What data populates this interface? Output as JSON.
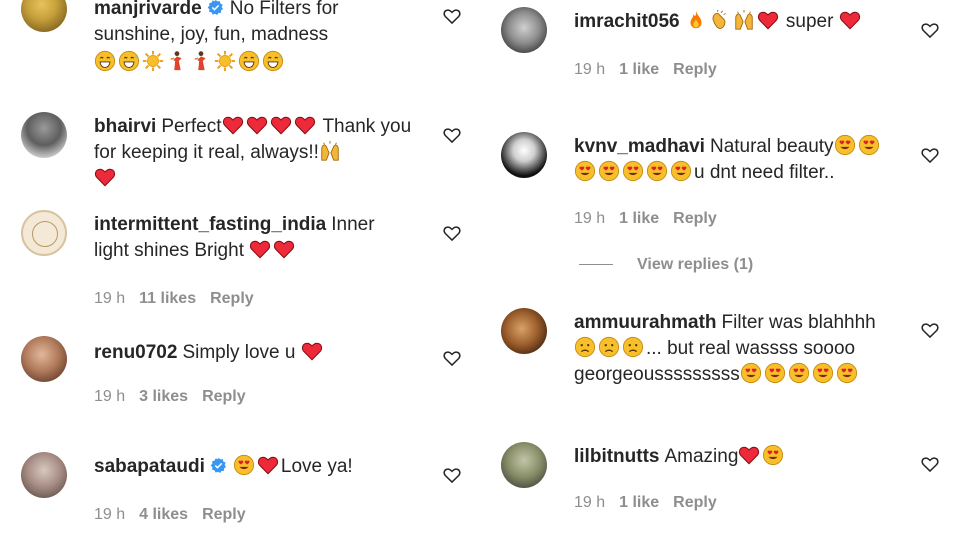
{
  "left": [
    {
      "username": "manjrivarde",
      "verified": true,
      "text": "No Filters for sunshine, joy, fun, madness",
      "emojis": [
        "grin-sweat",
        "grin-sweat",
        "sun",
        "dancer",
        "dancer",
        "sun",
        "grin-sweat",
        "grin-sweat"
      ],
      "time": "",
      "likes": "",
      "reply": ""
    },
    {
      "username": "bhairvi",
      "verified": false,
      "text_a": "Perfect",
      "text_b": "Thank you for keeping it real, always!!",
      "time": "",
      "likes": "",
      "reply": ""
    },
    {
      "username": "intermittent_fasting_india",
      "verified": false,
      "text": "Inner light shines Bright",
      "time": "19 h",
      "likes": "11 likes",
      "reply": "Reply"
    },
    {
      "username": "renu0702",
      "verified": false,
      "text": "Simply love u",
      "time": "19 h",
      "likes": "3 likes",
      "reply": "Reply"
    },
    {
      "username": "sabapataudi",
      "verified": true,
      "text": "Love ya!",
      "time": "19 h",
      "likes": "4 likes",
      "reply": "Reply"
    }
  ],
  "right": [
    {
      "username": "imrachit056",
      "text": "super",
      "time": "19 h",
      "likes": "1 like",
      "reply": "Reply"
    },
    {
      "username": "kvnv_madhavi",
      "text_a": "Natural beauty",
      "text_b": "u dnt need filter..",
      "time": "19 h",
      "likes": "1 like",
      "reply": "Reply",
      "view_replies": "View replies (1)"
    },
    {
      "username": "ammuurahmath",
      "text_a": "Filter was blahhhh",
      "text_b": "... but real wassss soooo",
      "text_c": "georgeousssssssss",
      "time": "",
      "likes": "",
      "reply": ""
    },
    {
      "username": "lilbitnutts",
      "text": "Amazing",
      "time": "19 h",
      "likes": "1 like",
      "reply": "Reply"
    }
  ],
  "colors": {
    "text": "#262626",
    "meta": "#8e8e8e",
    "verified": "#3897f0",
    "heart": "#ed2a3a",
    "emoji_face": "#f7c02b"
  }
}
